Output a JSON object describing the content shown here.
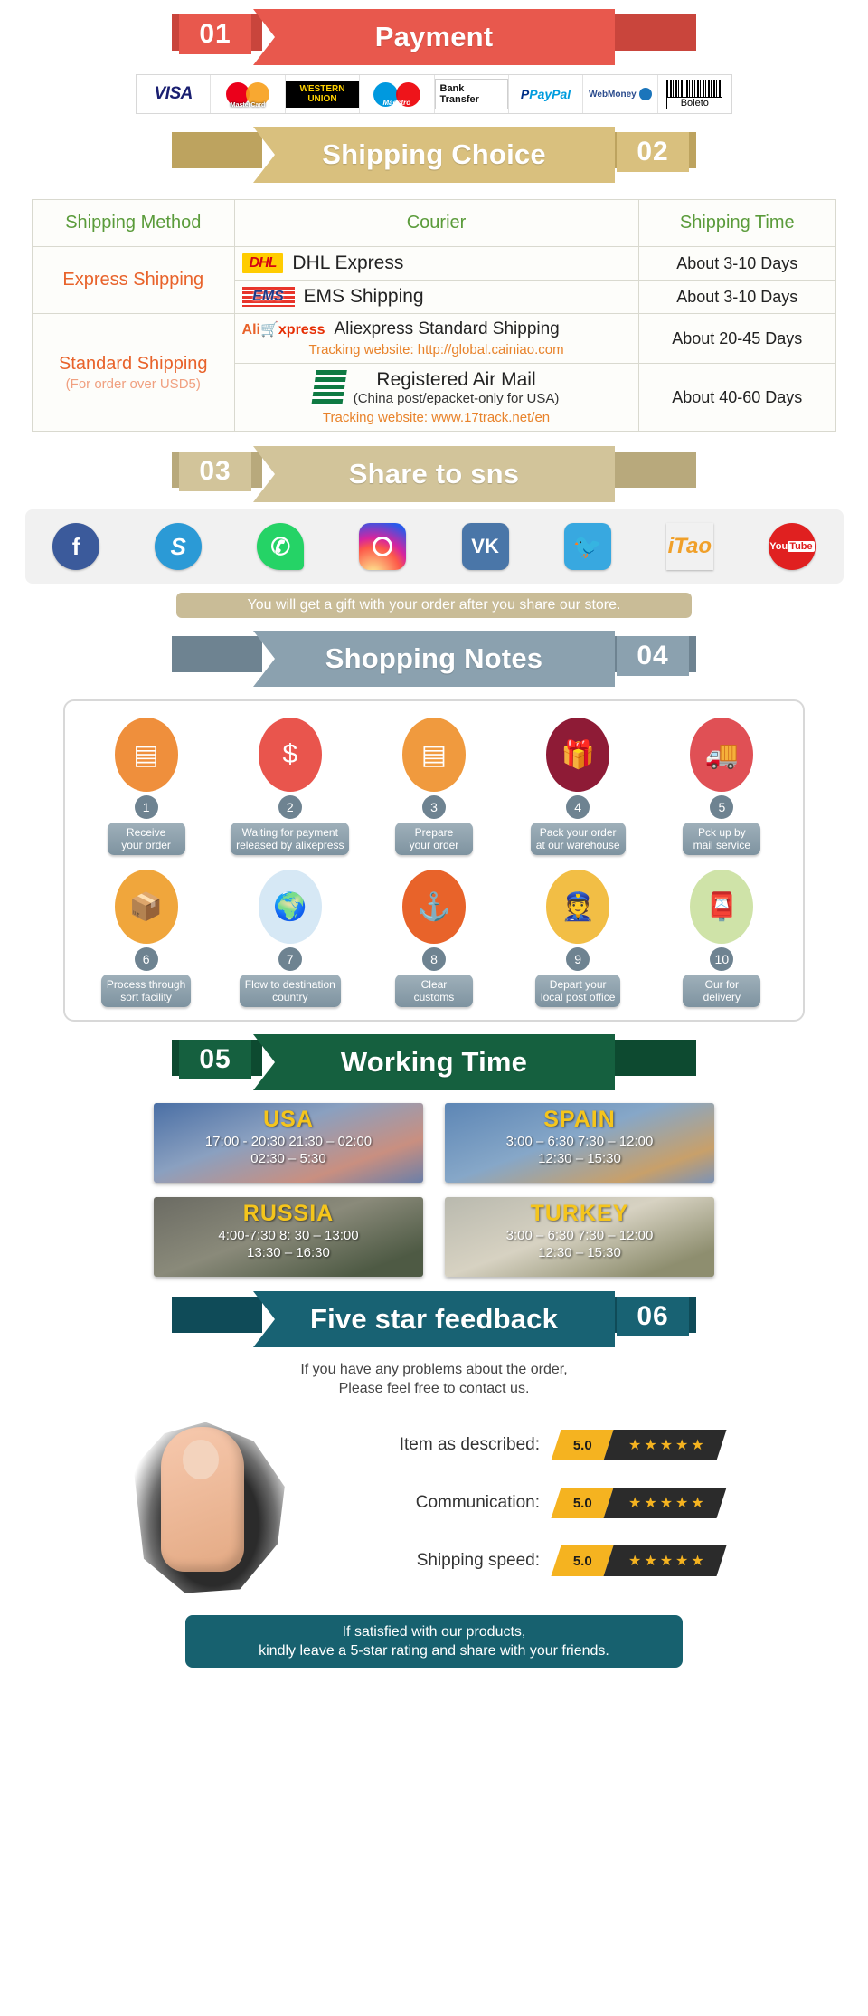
{
  "sections": {
    "payment": {
      "number": "01",
      "title": "Payment",
      "num_side": "left",
      "color": "#e8584d",
      "dark": "#c9453c"
    },
    "shipping": {
      "number": "02",
      "title": "Shipping Choice",
      "num_side": "right",
      "color": "#d9c07e",
      "dark": "#bda35f"
    },
    "sns": {
      "number": "03",
      "title": "Share to sns",
      "num_side": "left",
      "color": "#d2c49a",
      "dark": "#b8a97c"
    },
    "notes": {
      "number": "04",
      "title": "Shopping Notes",
      "num_side": "right",
      "color": "#8ba1af",
      "dark": "#6e8391"
    },
    "working": {
      "number": "05",
      "title": "Working Time",
      "num_side": "left",
      "color": "#15603f",
      "dark": "#0d4a30"
    },
    "feedback": {
      "number": "06",
      "title": "Five star feedback",
      "num_side": "right",
      "color": "#186273",
      "dark": "#0f4b58"
    }
  },
  "payment_methods": [
    {
      "name": "visa",
      "label": "VISA"
    },
    {
      "name": "mastercard",
      "label": "MasterCard"
    },
    {
      "name": "western-union",
      "label": "WESTERN UNION"
    },
    {
      "name": "maestro",
      "label": "Maestro"
    },
    {
      "name": "bank-transfer",
      "label": "Bank Transfer"
    },
    {
      "name": "paypal",
      "label": "PayPal"
    },
    {
      "name": "webmoney",
      "label": "WebMoney"
    },
    {
      "name": "boleto",
      "label": "Boleto"
    }
  ],
  "shipping_table": {
    "headers": [
      "Shipping Method",
      "Courier",
      "Shipping Time"
    ],
    "groups": [
      {
        "method": "Express Shipping",
        "method_note": "",
        "rows": [
          {
            "logo": "dhl",
            "courier": "DHL Express",
            "courier_sub": "",
            "tracking": "",
            "time": "About 3-10 Days"
          },
          {
            "logo": "ems",
            "courier": "EMS Shipping",
            "courier_sub": "",
            "tracking": "",
            "time": "About 3-10 Days"
          }
        ]
      },
      {
        "method": "Standard Shipping",
        "method_note": "(For order over USD5)",
        "rows": [
          {
            "logo": "aliexpress",
            "courier": "Aliexpress Standard Shipping",
            "courier_sub": "",
            "tracking": "Tracking website: http://global.cainiao.com",
            "time": "About 20-45 Days"
          },
          {
            "logo": "china-post",
            "courier": "Registered Air Mail",
            "courier_sub": "(China post/epacket-only for USA)",
            "tracking": "Tracking website: www.17track.net/en",
            "time": "About 40-60 Days"
          }
        ]
      }
    ]
  },
  "sns": {
    "icons": [
      {
        "name": "facebook-icon",
        "glyph": "f"
      },
      {
        "name": "skype-icon",
        "glyph": "S"
      },
      {
        "name": "whatsapp-icon",
        "glyph": "✆"
      },
      {
        "name": "instagram-icon",
        "glyph": ""
      },
      {
        "name": "vk-icon",
        "glyph": "VK"
      },
      {
        "name": "twitter-icon",
        "glyph": "🐦"
      },
      {
        "name": "itao-icon",
        "glyph": "iTao"
      },
      {
        "name": "youtube-icon",
        "glyph": "You"
      }
    ],
    "youtube_sub": "Tube",
    "note": "You will get a gift with your order after you share our store."
  },
  "shopping_notes": {
    "row1": [
      {
        "num": "1",
        "label": "Receive\nyour order",
        "icon": "document-icon",
        "bg": "#ef8f3c"
      },
      {
        "num": "2",
        "label": "Waiting for payment\nreleased by alixepress",
        "icon": "money-bag-icon",
        "bg": "#e9554d"
      },
      {
        "num": "3",
        "label": "Prepare\nyour order",
        "icon": "document-icon",
        "bg": "#f09a3e"
      },
      {
        "num": "4",
        "label": "Pack your order\nat our warehouse",
        "icon": "gift-box-icon",
        "bg": "#8e1b36"
      },
      {
        "num": "5",
        "label": "Pck up by\nmail service",
        "icon": "mail-truck-icon",
        "bg": "#e05055"
      }
    ],
    "row2": [
      {
        "num": "6",
        "label": "Process through\nsort facility",
        "icon": "hand-truck-icon",
        "bg": "#f0a63c"
      },
      {
        "num": "7",
        "label": "Flow to destination\ncountry",
        "icon": "globe-icon",
        "bg": "#d6e8f5"
      },
      {
        "num": "8",
        "label": "Clear\ncustoms",
        "icon": "anchor-icon",
        "bg": "#e8632a"
      },
      {
        "num": "9",
        "label": "Depart your\nlocal post office",
        "icon": "postman-icon",
        "bg": "#f2be45"
      },
      {
        "num": "10",
        "label": "Our for\ndelivery",
        "icon": "parcel-icon",
        "bg": "#cfe3a8"
      }
    ]
  },
  "working_time": [
    {
      "country": "USA",
      "theme": "wt-usa",
      "line1": "17:00 - 20:30  21:30 – 02:00",
      "line2": "02:30 – 5:30"
    },
    {
      "country": "SPAIN",
      "theme": "wt-spain",
      "line1": "3:00 – 6:30   7:30 – 12:00",
      "line2": "12:30 – 15:30"
    },
    {
      "country": "RUSSIA",
      "theme": "wt-russia",
      "line1": "4:00-7:30  8: 30 – 13:00",
      "line2": "13:30 – 16:30"
    },
    {
      "country": "TURKEY",
      "theme": "wt-turkey",
      "line1": "3:00 – 6:30   7:30 – 12:00",
      "line2": "12:30 – 15:30"
    }
  ],
  "feedback": {
    "intro_line1": "If you have any problems about the order,",
    "intro_line2": "Please feel free to contact us.",
    "ratings": [
      {
        "label": "Item as described:",
        "score": "5.0",
        "stars": "★★★★★"
      },
      {
        "label": "Communication:",
        "score": "5.0",
        "stars": "★★★★★"
      },
      {
        "label": "Shipping speed:",
        "score": "5.0",
        "stars": "★★★★★"
      }
    ],
    "footer_line1": "If satisfied with our products,",
    "footer_line2": "kindly leave a 5-star rating and share with your friends."
  }
}
